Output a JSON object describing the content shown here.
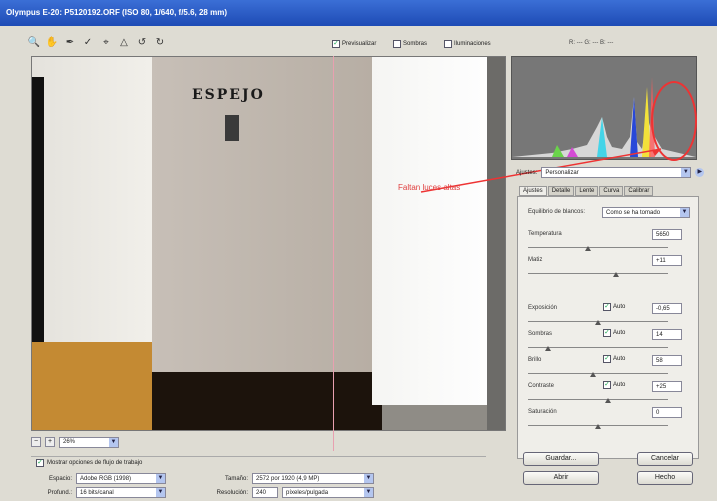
{
  "window": {
    "title": "Olympus E-20:  P5120192.ORF  (ISO 80, 1/640, f/5.6, 28 mm)"
  },
  "toolbar": {
    "tools": [
      "zoom-icon",
      "hand-icon",
      "eyedropper-icon",
      "color-sampler-icon",
      "crop-icon",
      "straighten-icon",
      "rotate-left-icon",
      "rotate-right-icon"
    ],
    "preview_label": "Previsualizar",
    "preview_checked": true,
    "shadows_label": "Sombras",
    "highlights_label": "Iluminaciones",
    "rgb_readout": "R: ---   G: ---   B: ---"
  },
  "photo": {
    "sign_text": "ESPEJO"
  },
  "zoom": {
    "minus": "−",
    "plus": "+",
    "value": "26%"
  },
  "workflow": {
    "show_options_label": "Mostrar opciones de flujo de trabajo",
    "show_options_checked": true,
    "space_label": "Espacio:",
    "space_value": "Adobe RGB (1998)",
    "depth_label": "Profund.:",
    "depth_value": "16 bits/canal",
    "size_label": "Tamaño:",
    "size_value": "2572 por 1920  (4,9 MP)",
    "resolution_label": "Resolución:",
    "resolution_value": "240",
    "resolution_unit": "píxeles/pulgada"
  },
  "annotation": {
    "text": "Faltan luces altas"
  },
  "settings": {
    "ajustes_label": "Ajustes:",
    "ajustes_value": "Personalizar",
    "tabs": [
      "Ajustes",
      "Detalle",
      "Lente",
      "Curva",
      "Calibrar"
    ],
    "white_balance_label": "Equilibrio de blancos:",
    "white_balance_value": "Como se ha tomado",
    "temperature_label": "Temperatura",
    "temperature_value": "5650",
    "tint_label": "Matiz",
    "tint_value": "+11",
    "exposure_label": "Exposición",
    "exposure_value": "-0,65",
    "shadows_label": "Sombras",
    "shadows_value": "14",
    "brightness_label": "Brillo",
    "brightness_value": "58",
    "contrast_label": "Contraste",
    "contrast_value": "+25",
    "saturation_label": "Saturación",
    "saturation_value": "0",
    "auto_label": "Auto"
  },
  "buttons": {
    "save": "Guardar...",
    "cancel": "Cancelar",
    "open": "Abrir",
    "done": "Hecho"
  }
}
